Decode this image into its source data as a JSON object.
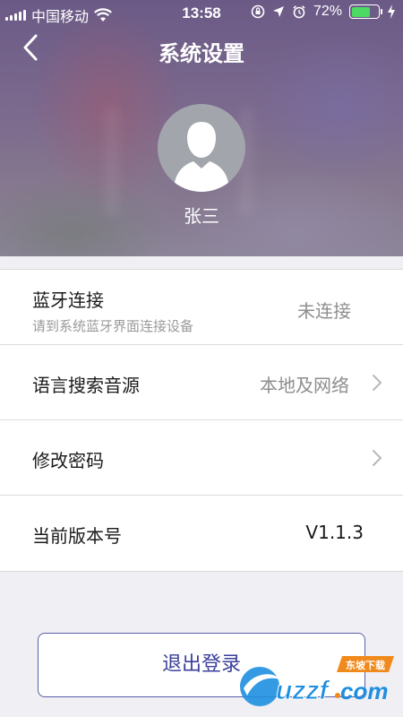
{
  "status_bar": {
    "carrier": "中国移动",
    "time": "13:58",
    "battery_percent": "72%",
    "battery_level": 0.72
  },
  "nav": {
    "title": "系统设置"
  },
  "profile": {
    "name": "张三"
  },
  "settings": {
    "bluetooth": {
      "label": "蓝牙连接",
      "sublabel": "请到系统蓝牙界面连接设备",
      "value": "未连接"
    },
    "voice_source": {
      "label": "语言搜索音源",
      "value": "本地及网络"
    },
    "change_password": {
      "label": "修改密码"
    },
    "version": {
      "label": "当前版本号",
      "value": "V1.1.3"
    }
  },
  "logout_label": "退出登录",
  "watermark": {
    "badge": "东坡下载",
    "text": "uzzf.com"
  },
  "colors": {
    "accent": "#3a3f9a",
    "battery": "#4cd964",
    "page_bg": "#efeff4"
  }
}
